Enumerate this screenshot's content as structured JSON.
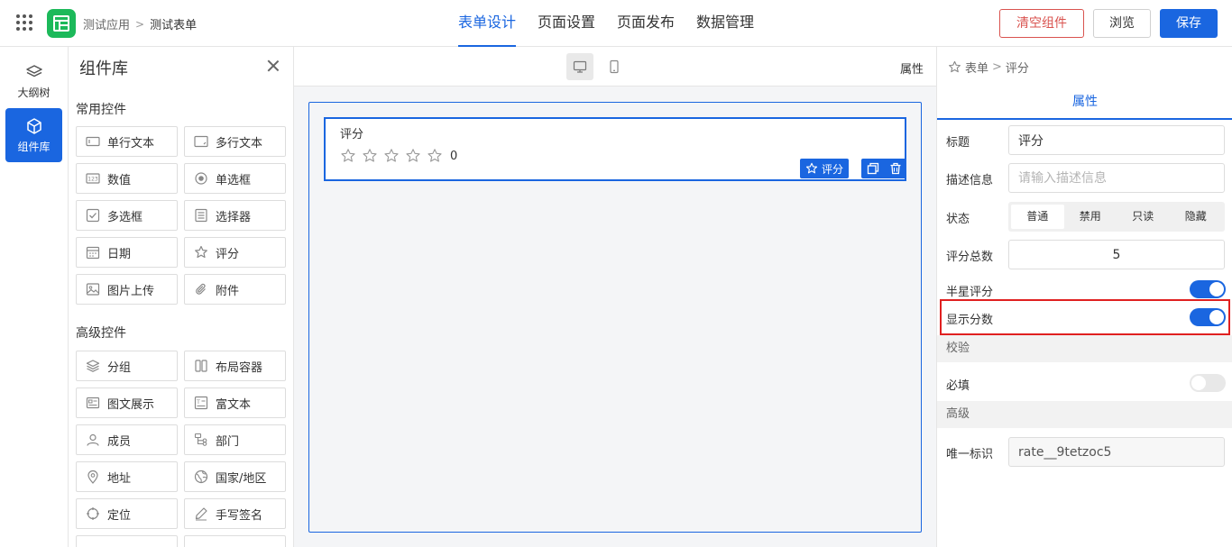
{
  "header": {
    "breadcrumb": {
      "app": "测试应用",
      "form": "测试表单"
    },
    "tabs": [
      "表单设计",
      "页面设置",
      "页面发布",
      "数据管理"
    ],
    "active_tab": "表单设计",
    "buttons": {
      "clear": "清空组件",
      "preview": "浏览",
      "save": "保存"
    }
  },
  "rail": {
    "outline": "大纲树",
    "library": "组件库"
  },
  "library": {
    "title": "组件库",
    "common_title": "常用控件",
    "common": [
      {
        "label": "单行文本",
        "icon": "single-line-text-icon"
      },
      {
        "label": "多行文本",
        "icon": "multi-line-text-icon"
      },
      {
        "label": "数值",
        "icon": "number-icon"
      },
      {
        "label": "单选框",
        "icon": "radio-icon"
      },
      {
        "label": "多选框",
        "icon": "checkbox-icon"
      },
      {
        "label": "选择器",
        "icon": "select-icon"
      },
      {
        "label": "日期",
        "icon": "calendar-icon"
      },
      {
        "label": "评分",
        "icon": "star-icon"
      },
      {
        "label": "图片上传",
        "icon": "image-icon"
      },
      {
        "label": "附件",
        "icon": "paperclip-icon"
      }
    ],
    "advanced_title": "高级控件",
    "advanced": [
      {
        "label": "分组",
        "icon": "layers-icon"
      },
      {
        "label": "布局容器",
        "icon": "columns-icon"
      },
      {
        "label": "图文展示",
        "icon": "card-icon"
      },
      {
        "label": "富文本",
        "icon": "rich-text-icon"
      },
      {
        "label": "成员",
        "icon": "user-icon"
      },
      {
        "label": "部门",
        "icon": "tree-icon"
      },
      {
        "label": "地址",
        "icon": "map-pin-icon"
      },
      {
        "label": "国家/地区",
        "icon": "globe-icon"
      },
      {
        "label": "定位",
        "icon": "crosshair-icon"
      },
      {
        "label": "手写签名",
        "icon": "pen-icon"
      }
    ]
  },
  "canvas": {
    "attr_label": "属性",
    "field": {
      "label": "评分",
      "stars": 5,
      "value": "0",
      "tag": "评分"
    }
  },
  "props": {
    "breadcrumb": {
      "root": "表单",
      "current": "评分"
    },
    "tab": "属性",
    "title_label": "标题",
    "title_value": "评分",
    "desc_label": "描述信息",
    "desc_placeholder": "请输入描述信息",
    "state_label": "状态",
    "state_options": [
      "普通",
      "禁用",
      "只读",
      "隐藏"
    ],
    "state_selected": "普通",
    "total_label": "评分总数",
    "total_value": "5",
    "half_label": "半星评分",
    "half_on": true,
    "show_score_label": "显示分数",
    "show_score_on": true,
    "validation_title": "校验",
    "required_label": "必填",
    "required_on": false,
    "advanced_title": "高级",
    "uid_label": "唯一标识",
    "uid_value": "rate__9tetzoc5"
  },
  "colors": {
    "accent": "#1a66e0",
    "danger": "#d9534f",
    "highlight": "#e02020",
    "logo": "#1cb95a"
  }
}
